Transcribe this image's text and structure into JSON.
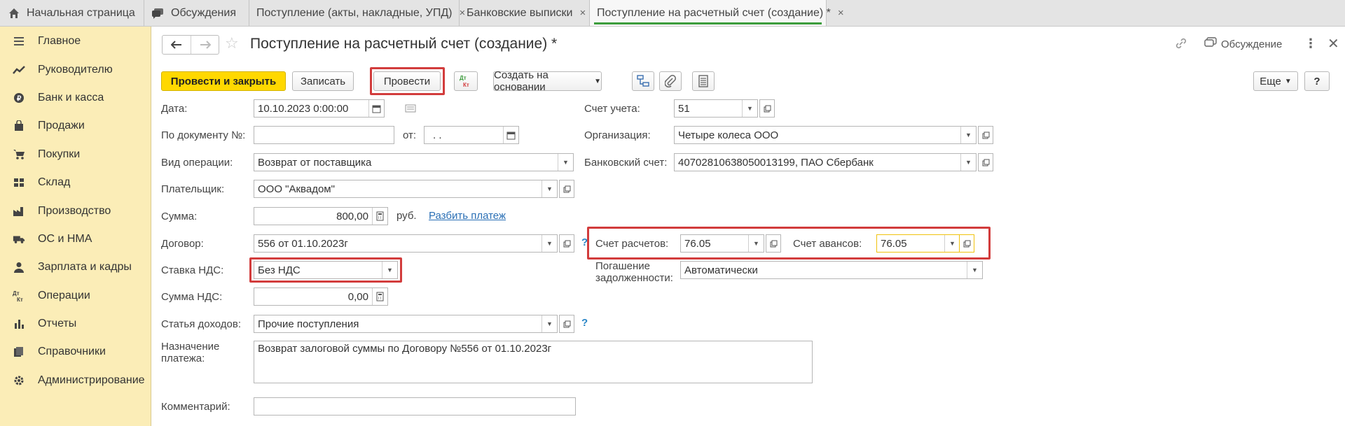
{
  "tabs": {
    "home": "Начальная страница",
    "discussions": "Обсуждения",
    "acts": "Поступление (акты, накладные, УПД)",
    "bank": "Банковские выписки",
    "active": "Поступление на расчетный счет (создание) *",
    "close_glyph": "×"
  },
  "sidebar": {
    "items": [
      {
        "label": "Главное",
        "icon": "menu-icon"
      },
      {
        "label": "Руководителю",
        "icon": "trend-icon"
      },
      {
        "label": "Банк и касса",
        "icon": "ruble-icon"
      },
      {
        "label": "Продажи",
        "icon": "bag-icon"
      },
      {
        "label": "Покупки",
        "icon": "cart-icon"
      },
      {
        "label": "Склад",
        "icon": "warehouse-icon"
      },
      {
        "label": "Производство",
        "icon": "factory-icon"
      },
      {
        "label": "ОС и НМА",
        "icon": "truck-icon"
      },
      {
        "label": "Зарплата и кадры",
        "icon": "person-icon"
      },
      {
        "label": "Операции",
        "icon": "dt-kt-icon"
      },
      {
        "label": "Отчеты",
        "icon": "bar-chart-icon"
      },
      {
        "label": "Справочники",
        "icon": "books-icon"
      },
      {
        "label": "Администрирование",
        "icon": "gear-icon"
      }
    ]
  },
  "header": {
    "title": "Поступление на расчетный счет (создание) *",
    "discussion_label": "Обсуждение"
  },
  "toolbar": {
    "post_close": "Провести и закрыть",
    "save": "Записать",
    "post": "Провести",
    "create_based": "Создать на основании",
    "more": "Еще",
    "help": "?"
  },
  "form": {
    "date_label": "Дата:",
    "date_value": "10.10.2023  0:00:00",
    "docnum_label": "По документу №:",
    "docnum_value": "",
    "from_label": "от:",
    "from_value": " .  .",
    "optype_label": "Вид операции:",
    "optype_value": "Возврат от поставщика",
    "payer_label": "Плательщик:",
    "payer_value": "ООО \"Аквадом\"",
    "sum_label": "Сумма:",
    "sum_value": "800,00",
    "currency": "руб.",
    "split_link": "Разбить платеж",
    "contract_label": "Договор:",
    "contract_value": "556 от 01.10.2023г",
    "vat_rate_label": "Ставка НДС:",
    "vat_rate_value": "Без НДС",
    "vat_sum_label": "Сумма НДС:",
    "vat_sum_value": "0,00",
    "income_label": "Статья доходов:",
    "income_value": "Прочие поступления",
    "purpose_label": "Назначение платежа:",
    "purpose_value": "Возврат залоговой суммы  по Договору №556 от 01.10.2023г",
    "comment_label": "Комментарий:",
    "comment_value": "",
    "account_label": "Счет учета:",
    "account_value": "51",
    "org_label": "Организация:",
    "org_value": "Четыре колеса ООО",
    "bank_acc_label": "Банковский счет:",
    "bank_acc_value": "40702810638050013199, ПАО Сбербанк",
    "settle_label": "Счет расчетов:",
    "settle_value": "76.05",
    "advance_label": "Счет авансов:",
    "advance_value": "76.05",
    "debt_label": "Погашение задолженности:",
    "debt_value": "Автоматически",
    "help_mark": "?"
  }
}
